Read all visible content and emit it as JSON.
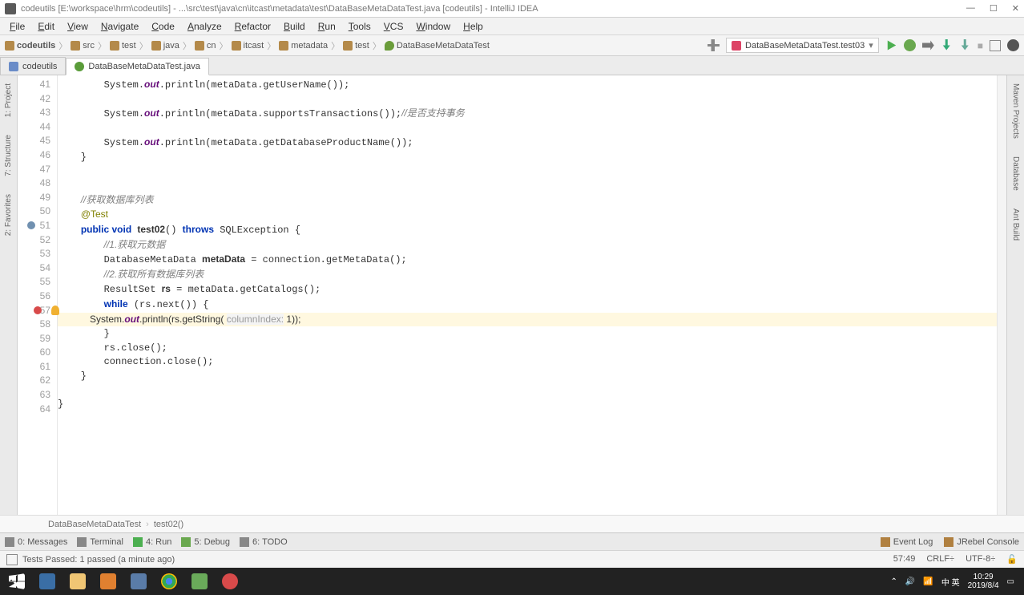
{
  "title": "codeutils [E:\\workspace\\hrm\\codeutils] - ...\\src\\test\\java\\cn\\itcast\\metadata\\test\\DataBaseMetaDataTest.java [codeutils] - IntelliJ IDEA",
  "menu": [
    "File",
    "Edit",
    "View",
    "Navigate",
    "Code",
    "Analyze",
    "Refactor",
    "Build",
    "Run",
    "Tools",
    "VCS",
    "Window",
    "Help"
  ],
  "crumbs": [
    "codeutils",
    "src",
    "test",
    "java",
    "cn",
    "itcast",
    "metadata",
    "test",
    "DataBaseMetaDataTest"
  ],
  "run_config": "DataBaseMetaDataTest.test03",
  "tabs": [
    {
      "label": "codeutils",
      "kind": "module"
    },
    {
      "label": "DataBaseMetaDataTest.java",
      "kind": "class"
    }
  ],
  "sidebar_left": [
    "1: Project",
    "7: Structure",
    "2: Favorites"
  ],
  "sidebar_right": [
    "Maven Projects",
    "Database",
    "Ant Build"
  ],
  "lines_start": 41,
  "lines": [
    "        System.<i>out</i>.println(metaData.getUserName());",
    "",
    "        System.<i>out</i>.println(metaData.supportsTransactions());<c>//是否支持事务</c>",
    "",
    "        System.<i>out</i>.println(metaData.getDatabaseProductName());",
    "    }",
    "",
    "",
    "    <c>//获取数据库列表</c>",
    "    <a>@Test</a>",
    "    <k>public void</k> <b>test02</b>() <k>throws</k> SQLException {",
    "        <c>//1.获取元数据</c>",
    "        DatabaseMetaData <b>metaData</b> = connection.getMetaData();",
    "        <c>//2.获取所有数据库列表</c>",
    "        ResultSet <b>rs</b> = metaData.getCatalogs();",
    "        <k>while</k> (rs.next()) {",
    "            System.<i>out</i>.println(rs.getString( <h>columnIndex:</h> 1));",
    "        }",
    "        rs.close();",
    "        connection.close();",
    "    }",
    "",
    "}",
    ""
  ],
  "breakpoint_line": 57,
  "highlight_line": 57,
  "breadcrumb2": [
    "DataBaseMetaDataTest",
    "test02()"
  ],
  "toolwin": {
    "items": [
      {
        "label": "0: Messages"
      },
      {
        "label": "Terminal"
      },
      {
        "label": "4: Run"
      },
      {
        "label": "5: Debug"
      },
      {
        "label": "6: TODO"
      }
    ],
    "right": [
      "Event Log",
      "JRebel Console"
    ]
  },
  "status": {
    "left": "Tests Passed: 1 passed (a minute ago)",
    "pos": "57:49",
    "le": "CRLF÷",
    "enc": "UTF-8÷",
    "lock": "🔓"
  },
  "tray": {
    "time": "10:29",
    "date": "2019/8/4",
    "ime": "中 英"
  }
}
